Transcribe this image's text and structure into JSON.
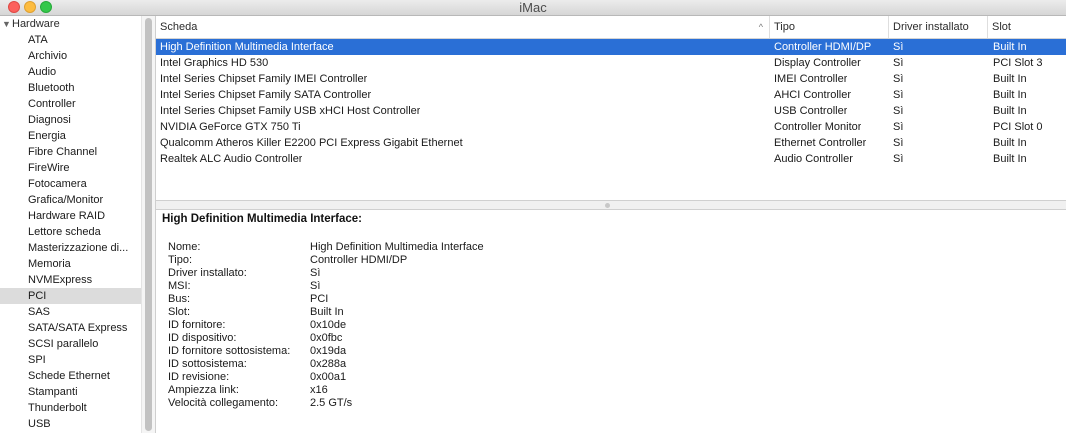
{
  "window": {
    "title": "iMac"
  },
  "sidebar": {
    "section": "Hardware",
    "items": [
      "ATA",
      "Archivio",
      "Audio",
      "Bluetooth",
      "Controller",
      "Diagnosi",
      "Energia",
      "Fibre Channel",
      "FireWire",
      "Fotocamera",
      "Grafica/Monitor",
      "Hardware RAID",
      "Lettore scheda",
      "Masterizzazione di...",
      "Memoria",
      "NVMExpress",
      "PCI",
      "SAS",
      "SATA/SATA Express",
      "SCSI parallelo",
      "SPI",
      "Schede Ethernet",
      "Stampanti",
      "Thunderbolt",
      "USB"
    ],
    "selected": "PCI"
  },
  "table": {
    "columns": {
      "card": "Scheda",
      "type": "Tipo",
      "driver": "Driver installato",
      "slot": "Slot"
    },
    "rows": [
      {
        "card": "High Definition Multimedia Interface",
        "type": "Controller HDMI/DP",
        "driver": "Sì",
        "slot": "Built In"
      },
      {
        "card": "Intel Graphics HD 530",
        "type": "Display Controller",
        "driver": "Sì",
        "slot": "PCI Slot 3"
      },
      {
        "card": "Intel Series Chipset Family IMEI Controller",
        "type": "IMEI Controller",
        "driver": "Sì",
        "slot": "Built In"
      },
      {
        "card": "Intel Series Chipset Family SATA Controller",
        "type": "AHCI Controller",
        "driver": "Sì",
        "slot": "Built In"
      },
      {
        "card": "Intel Series Chipset Family USB xHCI Host Controller",
        "type": "USB Controller",
        "driver": "Sì",
        "slot": "Built In"
      },
      {
        "card": "NVIDIA GeForce GTX 750 Ti",
        "type": "Controller Monitor",
        "driver": "Sì",
        "slot": "PCI Slot 0"
      },
      {
        "card": "Qualcomm Atheros Killer E2200 PCI Express Gigabit Ethernet",
        "type": "Ethernet Controller",
        "driver": "Sì",
        "slot": "Built In"
      },
      {
        "card": "Realtek ALC Audio Controller",
        "type": "Audio Controller",
        "driver": "Sì",
        "slot": "Built In"
      }
    ]
  },
  "detail": {
    "title": "High Definition Multimedia Interface:",
    "fields": [
      {
        "key": "Nome:",
        "value": "High Definition Multimedia Interface"
      },
      {
        "key": "Tipo:",
        "value": "Controller HDMI/DP"
      },
      {
        "key": "Driver installato:",
        "value": "Sì"
      },
      {
        "key": "MSI:",
        "value": "Sì"
      },
      {
        "key": "Bus:",
        "value": "PCI"
      },
      {
        "key": "Slot:",
        "value": "Built In"
      },
      {
        "key": "ID fornitore:",
        "value": "0x10de"
      },
      {
        "key": "ID dispositivo:",
        "value": "0x0fbc"
      },
      {
        "key": "ID fornitore sottosistema:",
        "value": "0x19da"
      },
      {
        "key": "ID sottosistema:",
        "value": "0x288a"
      },
      {
        "key": "ID revisione:",
        "value": "0x00a1"
      },
      {
        "key": "Ampiezza link:",
        "value": "x16"
      },
      {
        "key": "Velocità collegamento:",
        "value": "2.5 GT/s"
      }
    ]
  },
  "colors": {
    "selection": "#2a6fd6",
    "sidebar_selection": "#dcdcdc"
  }
}
